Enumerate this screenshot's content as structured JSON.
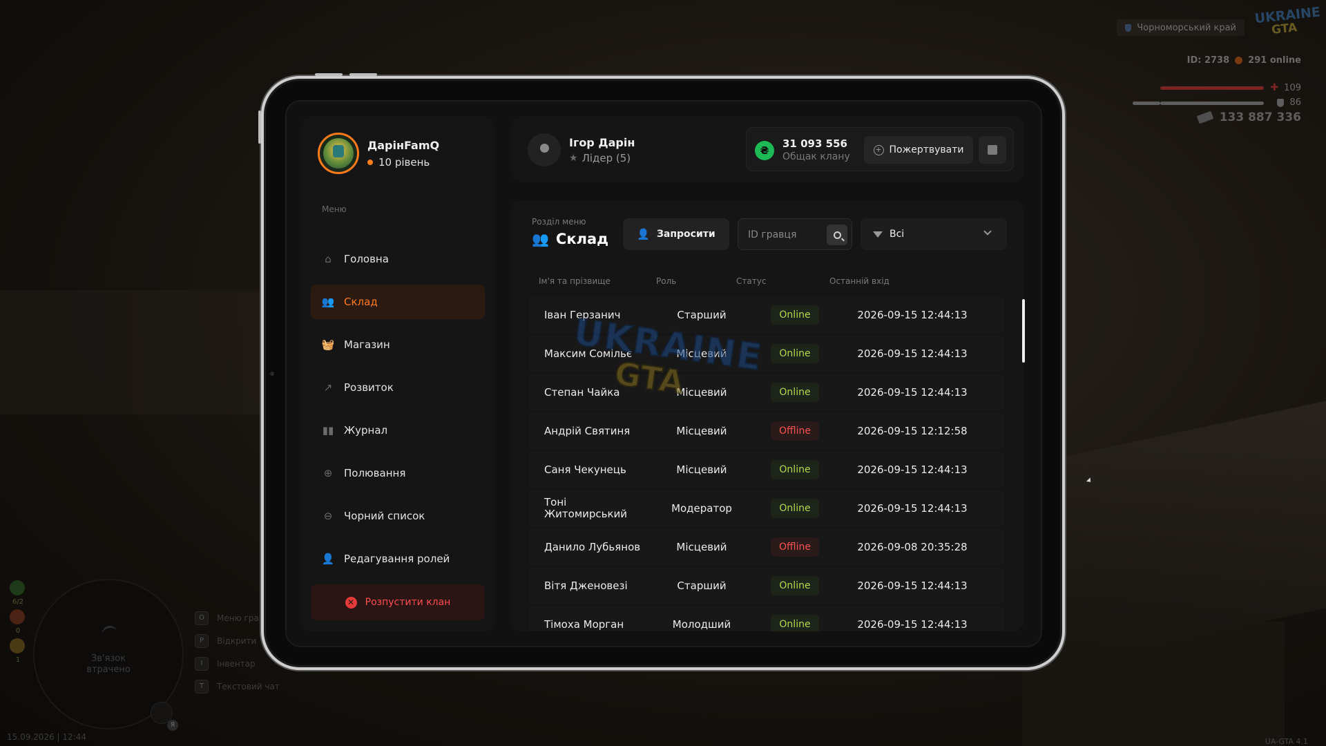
{
  "hud": {
    "server": "Чорноморський край",
    "logo_top": "UKRAINE",
    "logo_bottom": "GTA",
    "id_line": "ID: 2738",
    "online": "291 online",
    "hp": "109",
    "armor": "86",
    "money": "133 887 336",
    "radar_text_1": "Зв'язок",
    "radar_text_2": "втрачено",
    "mic_badge": "Я",
    "side_numbers": [
      "6/2",
      "0",
      "1"
    ],
    "keys": [
      {
        "key": "O",
        "label": "Меню гравця"
      },
      {
        "key": "P",
        "label": "Відкрити"
      },
      {
        "key": "I",
        "label": "Інвентар"
      },
      {
        "key": "T",
        "label": "Текстовий чат"
      }
    ],
    "datetime": "15.09.2026 | 12:44",
    "version": "UA-GTA 4.1"
  },
  "sidebar": {
    "clan_name": "ДарінFamQ",
    "clan_level": "10 рівень",
    "menu_caption": "Меню",
    "items": [
      {
        "label": "Головна",
        "icon": "home-icon"
      },
      {
        "label": "Склад",
        "icon": "people-icon",
        "active": true
      },
      {
        "label": "Магазин",
        "icon": "basket-icon"
      },
      {
        "label": "Розвиток",
        "icon": "chart-icon"
      },
      {
        "label": "Журнал",
        "icon": "book-icon"
      },
      {
        "label": "Полювання",
        "icon": "crosshair-icon"
      },
      {
        "label": "Чорний список",
        "icon": "ban-icon"
      },
      {
        "label": "Редагування ролей",
        "icon": "user-edit-icon"
      }
    ],
    "disband_label": "Розпустити клан"
  },
  "header": {
    "leader_name": "Ігор Дарін",
    "leader_role": "Лідер (5)",
    "bank_amount": "31 093 556",
    "bank_caption": "Общак клану",
    "donate_label": "Пожертвувати",
    "currency_symbol": "₴"
  },
  "main": {
    "section_caption": "Розділ меню",
    "section_title": "Склад",
    "invite_label": "Запросити",
    "search_placeholder": "ID гравця",
    "filter_value": "Всі",
    "columns": [
      "Ім'я та прізвище",
      "Роль",
      "Статус",
      "Останній вхід"
    ],
    "members": [
      {
        "name": "Іван Герзанич",
        "role": "Старший",
        "status": "Online",
        "last": "2026-09-15 12:44:13"
      },
      {
        "name": "Максим Сомільє",
        "role": "Місцевий",
        "status": "Online",
        "last": "2026-09-15 12:44:13"
      },
      {
        "name": "Степан Чайка",
        "role": "Місцевий",
        "status": "Online",
        "last": "2026-09-15 12:44:13"
      },
      {
        "name": "Андрій Святиня",
        "role": "Місцевий",
        "status": "Offline",
        "last": "2026-09-15 12:12:58"
      },
      {
        "name": "Саня Чекунець",
        "role": "Місцевий",
        "status": "Online",
        "last": "2026-09-15 12:44:13"
      },
      {
        "name": "Тоні Житомирський",
        "role": "Модератор",
        "status": "Online",
        "last": "2026-09-15 12:44:13"
      },
      {
        "name": "Данило Лубьянов",
        "role": "Місцевий",
        "status": "Offline",
        "last": "2026-09-08 20:35:28"
      },
      {
        "name": "Вітя Дженовезі",
        "role": "Старший",
        "status": "Online",
        "last": "2026-09-15 12:44:13"
      },
      {
        "name": "Тімоха Морган",
        "role": "Молодший",
        "status": "Online",
        "last": "2026-09-15 12:44:13"
      }
    ]
  },
  "colors": {
    "accent": "#ff7a1a",
    "online": "#b7d94a",
    "offline": "#ff5151",
    "money": "#1db954"
  }
}
